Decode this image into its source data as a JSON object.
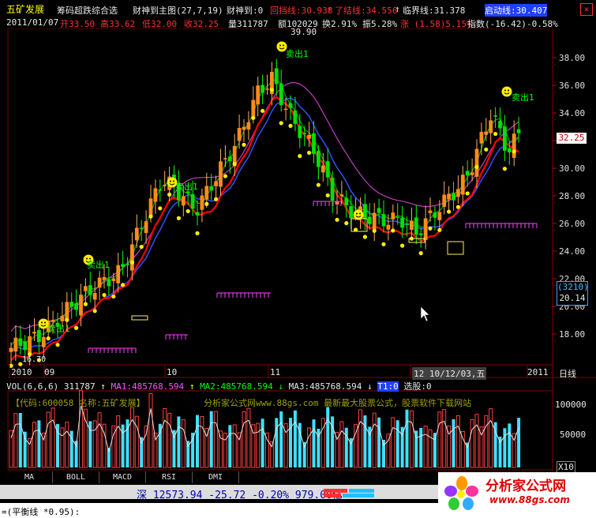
{
  "header": {
    "stock_name": "五矿发展",
    "formula_name": "筹码超跌综合选",
    "caifu_label": "财神到主图(27,7,19)",
    "caifu_val": "财神到:0",
    "huidang": "回挡线:30.938",
    "liaojie": "了结线:34.556",
    "linjie": "临界线:31.378",
    "qidong": "启动线:30.407",
    "date": "2011/01/07",
    "open": "开33.50",
    "high": "高33.62",
    "low": "低32.00",
    "close": "收32.25",
    "volume": "量311787",
    "amount": "额102029",
    "turnover": "换2.91%",
    "amplitude": "振5.28%",
    "change": "涨 (1.58)5.15%",
    "index_change": "指数(-16.42)-0.58%"
  },
  "price_axis": [
    "38.00",
    "36.00",
    "34.00",
    "32.00",
    "30.00",
    "28.00",
    "26.00",
    "24.00",
    "22.00",
    "20.00",
    "18.00"
  ],
  "price_tag": "32.25",
  "crosshair_box": {
    "line1": "(3210)",
    "line2": "20.14"
  },
  "annotations": {
    "high_label": "39.90",
    "low_label": "16.70",
    "sell_label": "卖出1",
    "date_label": "12 10/12/03,五"
  },
  "time_axis": {
    "labels": [
      "2010",
      "09",
      "10",
      "11",
      "2011"
    ],
    "day_label": "日线"
  },
  "volume_panel": {
    "legend_vol": "VOL(6,6,6) 311787",
    "legend_ma1": "MA1:485768.594",
    "legend_ma2": "MA2:485768.594",
    "legend_ma3": "MA3:485768.594",
    "legend_t": "T1:0",
    "legend_select": "选股:0",
    "axis": [
      "100000",
      "50000"
    ],
    "multiplier": "X10",
    "watermark_code": "【代码:600058 名称:五矿发展】",
    "watermark_site": "分析家公式网www.88gs.com 最新最大股票公式，股票软件下载网站"
  },
  "tabs": [
    "MA",
    "BOLL",
    "MACD",
    "RSI",
    "DMI"
  ],
  "status": {
    "market": "深",
    "index": "12573.94",
    "change": "-25.72",
    "pct": "-0.20%",
    "amount": "979.00亿"
  },
  "bottom": {
    "text": "=(平衡线 *0.95):"
  },
  "logo": {
    "name": "分析家公式网",
    "url": "www.88gs.com"
  },
  "colors": {
    "bull": "#ff8c1a",
    "bear": "#00e000",
    "ma_red": "#ff0000",
    "ma_blue": "#3050ff",
    "ma_magenta": "#c040c0",
    "background": "#000000"
  }
}
